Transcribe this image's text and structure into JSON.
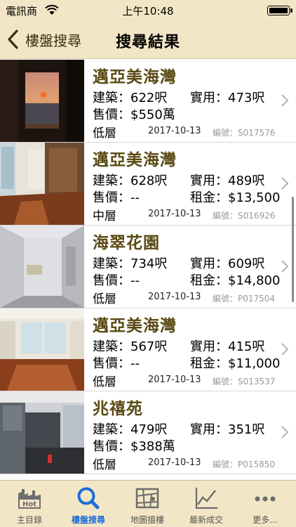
{
  "status_bar": {
    "carrier": "電訊商",
    "time": "上午10:48"
  },
  "nav": {
    "back_label": "樓盤搜尋",
    "title": "搜尋結果"
  },
  "listings": [
    {
      "name": "邁亞美海灣",
      "area_label": "建築：622呎",
      "net_label": "實用：473呎",
      "price_label": "售價：$550萬",
      "rent_label": "",
      "floor": "低層",
      "date": "2017-10-13",
      "code": "編號：S017576",
      "photo": "sunset-window-photo"
    },
    {
      "name": "邁亞美海灣",
      "area_label": "建築：628呎",
      "net_label": "實用：489呎",
      "price_label": "售價：--",
      "rent_label": "租金：$13,500",
      "floor": "中層",
      "date": "2017-10-13",
      "code": "編號：S016926",
      "photo": "wood-floor-room-photo"
    },
    {
      "name": "海翠花園",
      "area_label": "建築：734呎",
      "net_label": "實用：609呎",
      "price_label": "售價：--",
      "rent_label": "租金：$14,800",
      "floor": "低層",
      "date": "2017-10-13",
      "code": "編號：P017504",
      "photo": "empty-room-photo"
    },
    {
      "name": "邁亞美海灣",
      "area_label": "建築：567呎",
      "net_label": "實用：415呎",
      "price_label": "售價：--",
      "rent_label": "租金：$11,000",
      "floor": "低層",
      "date": "2017-10-13",
      "code": "編號：S013537",
      "photo": "living-room-photo"
    },
    {
      "name": "兆禧苑",
      "area_label": "建築：479呎",
      "net_label": "實用：351呎",
      "price_label": "售價：$388萬",
      "rent_label": "",
      "floor": "低層",
      "date": "2017-10-13",
      "code": "編號：P015850",
      "photo": "kitchen-photo"
    }
  ],
  "tabs": [
    {
      "label": "主目錄",
      "icon": "hot-building-icon",
      "active": false
    },
    {
      "label": "樓盤搜尋",
      "icon": "search-icon",
      "active": true
    },
    {
      "label": "地圖搵樓",
      "icon": "map-icon",
      "active": false
    },
    {
      "label": "最新成交",
      "icon": "chart-icon",
      "active": false
    },
    {
      "label": "更多...",
      "icon": "more-icon",
      "active": false
    }
  ],
  "colors": {
    "bar_bg": "#f3e6c6",
    "title_gold": "#5a4a14",
    "active_tab": "#1a6ed8"
  }
}
